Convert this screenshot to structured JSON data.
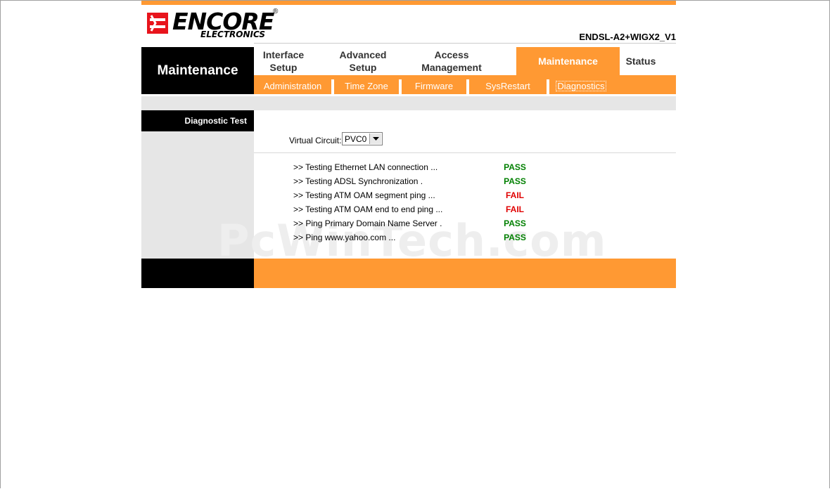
{
  "brand": {
    "logo_main": "ENCORE",
    "logo_sub": "ELECTRONICS",
    "logo_reg": "®",
    "model": "ENDSL-A2+WIGX2_V1",
    "accent_color": "#ff9933"
  },
  "section_title": "Maintenance",
  "main_nav": [
    {
      "label": "Interface\nSetup",
      "active": false
    },
    {
      "label": "Advanced\nSetup",
      "active": false
    },
    {
      "label": "Access\nManagement",
      "active": false
    },
    {
      "label": "Maintenance",
      "active": true
    },
    {
      "label": "Status",
      "active": false
    }
  ],
  "sub_nav": [
    {
      "label": "Administration",
      "active": false
    },
    {
      "label": "Time Zone",
      "active": false
    },
    {
      "label": "Firmware",
      "active": false
    },
    {
      "label": "SysRestart",
      "active": false
    },
    {
      "label": "Diagnostics",
      "active": true
    }
  ],
  "left_panel": {
    "title": "Diagnostic Test"
  },
  "virtual_circuit": {
    "label": "Virtual Circuit:",
    "selected": "PVC0"
  },
  "tests": [
    {
      "name": ">> Testing Ethernet LAN connection ...",
      "result": "PASS",
      "color": "#008000"
    },
    {
      "name": ">> Testing ADSL Synchronization .",
      "result": "PASS",
      "color": "#008000"
    },
    {
      "name": ">> Testing ATM OAM segment ping ...",
      "result": "FAIL",
      "color": "#e00000"
    },
    {
      "name": ">> Testing ATM OAM end to end ping ...",
      "result": "FAIL",
      "color": "#e00000"
    },
    {
      "name": ">> Ping Primary Domain Name Server .",
      "result": "PASS",
      "color": "#008000"
    },
    {
      "name": ">> Ping www.yahoo.com ...",
      "result": "PASS",
      "color": "#008000"
    }
  ],
  "watermark": "PcWinTech.com"
}
